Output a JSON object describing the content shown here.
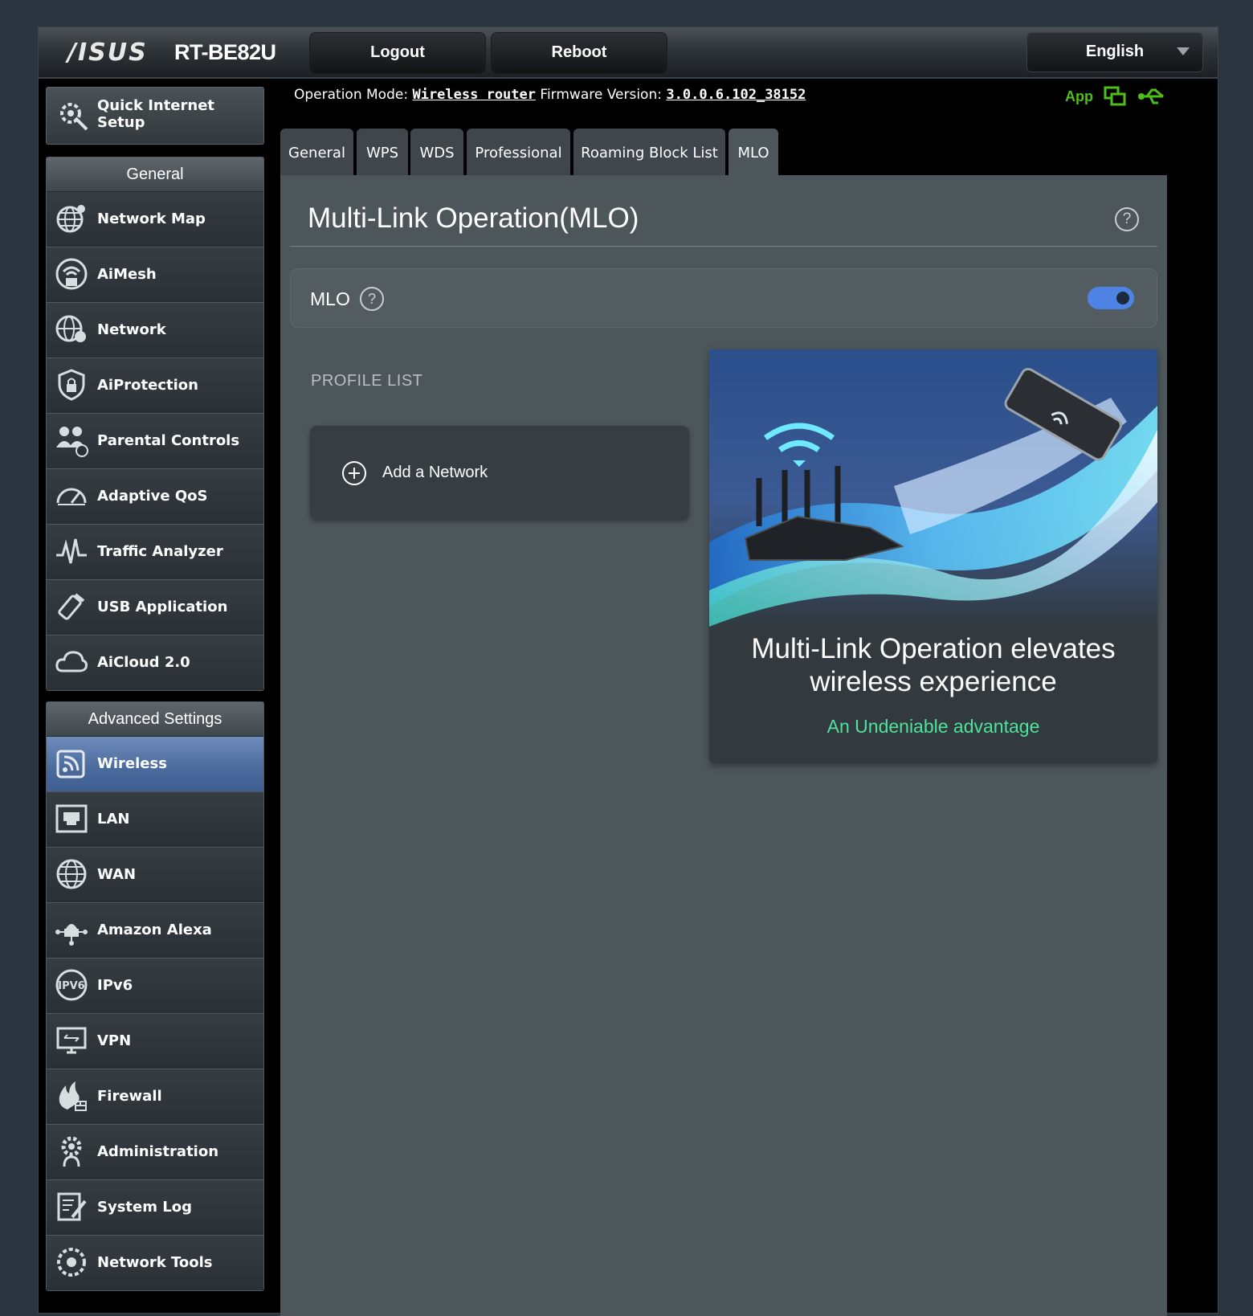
{
  "header": {
    "brand": "/ISUS",
    "model": "RT-BE82U",
    "logout_label": "Logout",
    "reboot_label": "Reboot",
    "language": "English"
  },
  "status": {
    "op_mode_label": "Operation Mode:",
    "op_mode_value": "Wireless router",
    "fw_label": "Firmware Version:",
    "fw_value": "3.0.0.6.102_38152",
    "app_label": "App"
  },
  "sidebar": {
    "qis_label": "Quick Internet Setup",
    "general_header": "General",
    "general_items": [
      {
        "label": "Network Map",
        "icon": "globe-network-icon"
      },
      {
        "label": "AiMesh",
        "icon": "aimesh-icon"
      },
      {
        "label": "Network",
        "icon": "network-globe-icon"
      },
      {
        "label": "AiProtection",
        "icon": "shield-lock-icon"
      },
      {
        "label": "Parental Controls",
        "icon": "family-icon"
      },
      {
        "label": "Adaptive QoS",
        "icon": "speedometer-icon"
      },
      {
        "label": "Traffic Analyzer",
        "icon": "pulse-icon"
      },
      {
        "label": "USB Application",
        "icon": "usb-icon"
      },
      {
        "label": "AiCloud 2.0",
        "icon": "cloud-icon"
      }
    ],
    "advanced_header": "Advanced Settings",
    "advanced_items": [
      {
        "label": "Wireless",
        "icon": "wireless-icon",
        "active": true
      },
      {
        "label": "LAN",
        "icon": "lan-port-icon"
      },
      {
        "label": "WAN",
        "icon": "wan-globe-icon"
      },
      {
        "label": "Amazon Alexa",
        "icon": "alexa-icon"
      },
      {
        "label": "IPv6",
        "icon": "ipv6-icon"
      },
      {
        "label": "VPN",
        "icon": "vpn-monitor-icon"
      },
      {
        "label": "Firewall",
        "icon": "fire-wall-icon"
      },
      {
        "label": "Administration",
        "icon": "gear-person-icon"
      },
      {
        "label": "System Log",
        "icon": "log-pen-icon"
      },
      {
        "label": "Network Tools",
        "icon": "network-tools-icon"
      }
    ]
  },
  "tabs": [
    "General",
    "WPS",
    "WDS",
    "Professional",
    "Roaming Block List",
    "MLO"
  ],
  "active_tab": "MLO",
  "main": {
    "title": "Multi-Link Operation(MLO)",
    "mlo_label": "MLO",
    "mlo_enabled": true,
    "profile_list_label": "PROFILE LIST",
    "add_network_label": "Add a Network",
    "promo_headline_line1": "Multi-Link Operation elevates",
    "promo_headline_line2": "wireless experience",
    "promo_sub": "An Undeniable advantage"
  },
  "colors": {
    "accent_blue": "#4e83e6",
    "active_menu": "#4a6a9c",
    "promo_green": "#4fe39a",
    "app_green": "#4fbe1b"
  }
}
